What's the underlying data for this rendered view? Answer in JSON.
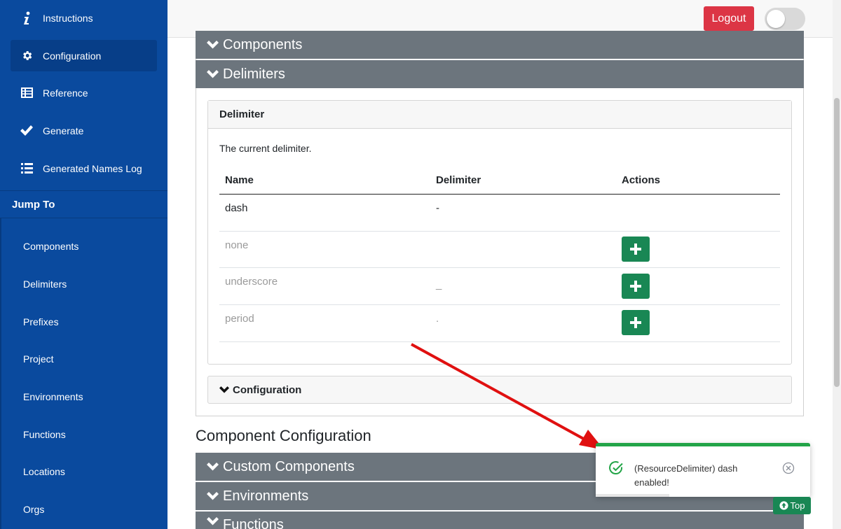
{
  "sidebar": {
    "items": [
      {
        "label": "Instructions",
        "icon": "info-icon"
      },
      {
        "label": "Configuration",
        "icon": "gear-icon"
      },
      {
        "label": "Reference",
        "icon": "table-icon"
      },
      {
        "label": "Generate",
        "icon": "check-icon"
      },
      {
        "label": "Generated Names Log",
        "icon": "list-icon"
      }
    ],
    "jump_to_title": "Jump To",
    "jump_items": [
      "Components",
      "Delimiters",
      "Prefixes",
      "Project",
      "Environments",
      "Functions",
      "Locations",
      "Orgs"
    ]
  },
  "header": {
    "logout_label": "Logout"
  },
  "sections": {
    "components": "Components",
    "delimiters": "Delimiters",
    "custom_components": "Custom Components",
    "environments": "Environments",
    "functions": "Functions",
    "component_configuration": "Component Configuration"
  },
  "delimiter_card": {
    "title": "Delimiter",
    "description": "The current delimiter.",
    "columns": [
      "Name",
      "Delimiter",
      "Actions"
    ],
    "rows": [
      {
        "name": "dash",
        "delimiter": "-"
      },
      {
        "name": "none",
        "delimiter": ""
      },
      {
        "name": "underscore",
        "delimiter": "_"
      },
      {
        "name": "period",
        "delimiter": "."
      }
    ],
    "configuration_label": "Configuration"
  },
  "toast": {
    "message": "(ResourceDelimiter) dash enabled!"
  },
  "top_button": "Top",
  "colors": {
    "sidebar": "#0a4a9e",
    "logout": "#dc3545",
    "section_bar": "#6c757d",
    "add_button": "#198754",
    "toast_accent": "#22a447",
    "arrow": "#e01010"
  }
}
